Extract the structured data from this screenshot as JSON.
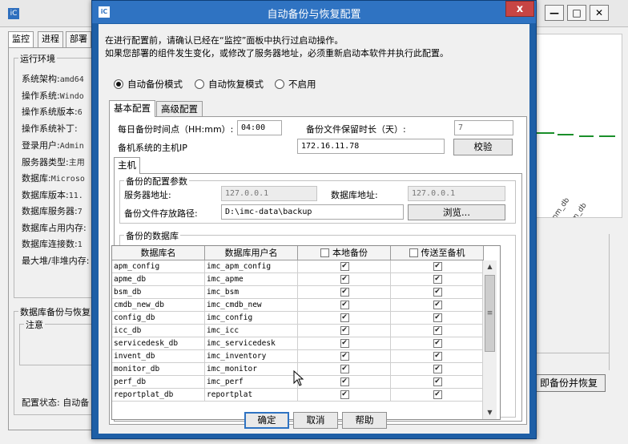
{
  "background": {
    "tabs": [
      "监控",
      "进程",
      "部署"
    ],
    "group_runtime": "运行环境",
    "rows": [
      {
        "label": "系统架构:",
        "value": "amd64"
      },
      {
        "label": "操作系统:",
        "value": "Windo"
      },
      {
        "label": "操作系统版本:",
        "value": "6"
      },
      {
        "label": "操作系统补丁:",
        "value": ""
      },
      {
        "label": "登录用户:",
        "value": "Admin"
      },
      {
        "label": "服务器类型:",
        "value": "主用"
      },
      {
        "label": "数据库:",
        "value": "Microso"
      },
      {
        "label": "数据库版本:",
        "value": "11."
      },
      {
        "label": "数据库服务器:",
        "value": "7"
      },
      {
        "label": "数据库占用内存:",
        "value": ""
      },
      {
        "label": "数据库连接数:",
        "value": "1"
      },
      {
        "label": "最大堆/非堆内存:",
        "value": ""
      }
    ],
    "group_backup": "数据库备份与恢复",
    "note": "注意",
    "config_status": "配置状态: 自动备",
    "chart_labels": [
      "vlanm_db",
      "vnm_db"
    ],
    "right_button": "即备份并恢复",
    "window_buttons": {
      "minimize": "—",
      "maximize": "□",
      "close": "✕"
    }
  },
  "dialog": {
    "title": "自动备份与恢复配置",
    "close": "x",
    "info_line1": "在进行配置前，请确认已经在“监控”面板中执行过启动操作。",
    "info_line2": "如果您部署的组件发生变化，或修改了服务器地址，必须重新启动本软件并执行此配置。",
    "modes": [
      {
        "label": "自动备份模式",
        "selected": true
      },
      {
        "label": "自动恢复模式",
        "selected": false
      },
      {
        "label": "不启用",
        "selected": false
      }
    ],
    "tabs": [
      "基本配置",
      "高级配置"
    ],
    "time_label": "每日备份时间点（HH:mm）:",
    "time_value": "04:00",
    "retention_label": "备份文件保留时长（天）:",
    "retention_value": "7",
    "host_ip_label": "备机系统的主机IP",
    "host_ip_value": "172.16.11.78",
    "verify_button": "校验",
    "subtab": "主机",
    "params_group": "备份的配置参数",
    "server_addr_label": "服务器地址:",
    "server_addr_value": "127.0.0.1",
    "db_addr_label": "数据库地址:",
    "db_addr_value": "127.0.0.1",
    "backup_path_label": "备份文件存放路径:",
    "backup_path_value": "D:\\imc-data\\backup",
    "browse_button": "浏览...",
    "db_group": "备份的数据库",
    "table": {
      "columns": [
        "数据库名",
        "数据库用户名",
        "本地备份",
        "传送至备机"
      ],
      "rows": [
        {
          "db": "apm_config",
          "user": "imc_apm_config",
          "local": true,
          "remote": true
        },
        {
          "db": "apme_db",
          "user": "imc_apme",
          "local": true,
          "remote": true
        },
        {
          "db": "bsm_db",
          "user": "imc_bsm",
          "local": true,
          "remote": true
        },
        {
          "db": "cmdb_new_db",
          "user": "imc_cmdb_new",
          "local": true,
          "remote": true
        },
        {
          "db": "config_db",
          "user": "imc_config",
          "local": true,
          "remote": true
        },
        {
          "db": "icc_db",
          "user": "imc_icc",
          "local": true,
          "remote": true
        },
        {
          "db": "servicedesk_db",
          "user": "imc_servicedesk",
          "local": true,
          "remote": true
        },
        {
          "db": "invent_db",
          "user": "imc_inventory",
          "local": true,
          "remote": true
        },
        {
          "db": "monitor_db",
          "user": "imc_monitor",
          "local": true,
          "remote": true
        },
        {
          "db": "perf_db",
          "user": "imc_perf",
          "local": true,
          "remote": true
        },
        {
          "db": "reportplat_db",
          "user": "reportplat",
          "local": true,
          "remote": true
        }
      ]
    },
    "ok_button": "确定",
    "cancel_button": "取消",
    "help_button": "帮助"
  }
}
